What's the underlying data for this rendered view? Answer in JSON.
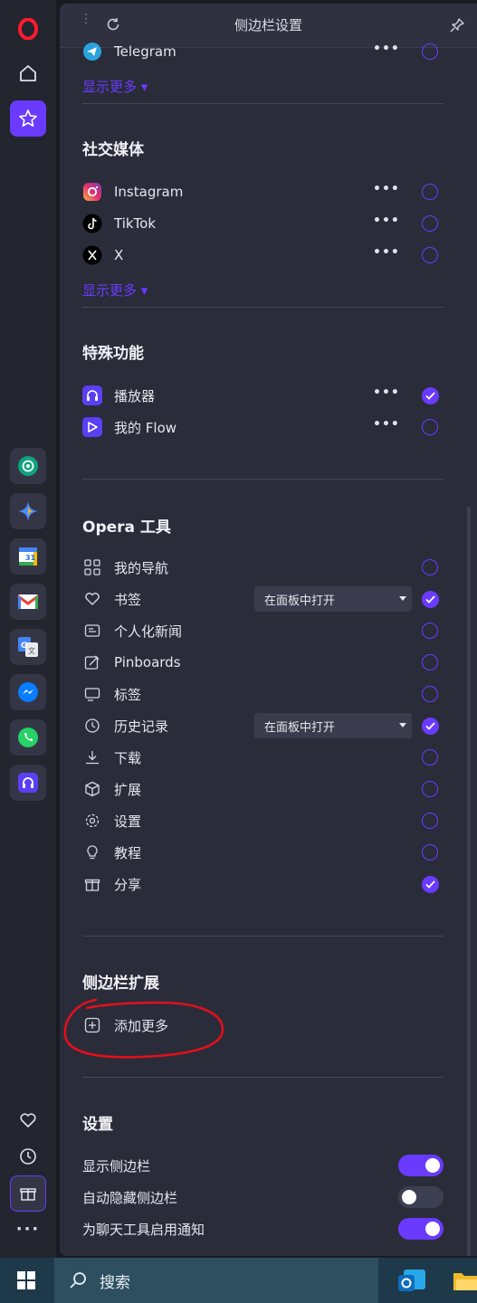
{
  "panel": {
    "title": "侧边栏设置"
  },
  "messengers": {
    "partial_item": "Telegram",
    "show_more": "显示更多"
  },
  "social": {
    "title": "社交媒体",
    "items": [
      {
        "label": "Instagram",
        "enabled": false
      },
      {
        "label": "TikTok",
        "enabled": false
      },
      {
        "label": "X",
        "enabled": false
      }
    ],
    "show_more": "显示更多"
  },
  "special": {
    "title": "特殊功能",
    "items": [
      {
        "label": "播放器",
        "enabled": true
      },
      {
        "label": "我的 Flow",
        "enabled": false
      }
    ]
  },
  "opera_tools": {
    "title": "Opera 工具",
    "items": [
      {
        "label": "我的导航",
        "icon": "grid-icon",
        "enabled": false
      },
      {
        "label": "书签",
        "icon": "heart-icon",
        "enabled": true,
        "select": "在面板中打开"
      },
      {
        "label": "个人化新闻",
        "icon": "news-icon",
        "enabled": false
      },
      {
        "label": "Pinboards",
        "icon": "pinboard-icon",
        "enabled": false
      },
      {
        "label": "标签",
        "icon": "tabs-icon",
        "enabled": false
      },
      {
        "label": "历史记录",
        "icon": "clock-icon",
        "enabled": true,
        "select": "在面板中打开"
      },
      {
        "label": "下载",
        "icon": "download-icon",
        "enabled": false
      },
      {
        "label": "扩展",
        "icon": "cube-icon",
        "enabled": false
      },
      {
        "label": "设置",
        "icon": "gear-icon",
        "enabled": false
      },
      {
        "label": "教程",
        "icon": "lightbulb-icon",
        "enabled": false
      },
      {
        "label": "分享",
        "icon": "gift-icon",
        "enabled": true
      }
    ]
  },
  "extensions": {
    "title": "侧边栏扩展",
    "add_more": "添加更多"
  },
  "settings": {
    "title": "设置",
    "items": [
      {
        "label": "显示侧边栏",
        "on": true
      },
      {
        "label": "自动隐藏侧边栏",
        "on": false
      },
      {
        "label": "为聊天工具启用通知",
        "on": true
      }
    ]
  },
  "taskbar": {
    "search_placeholder": "搜索"
  },
  "colors": {
    "accent": "#6a3bff",
    "panel_bg": "#2a2c3a",
    "rail_bg": "#23252f",
    "annotation": "#e0101a"
  }
}
